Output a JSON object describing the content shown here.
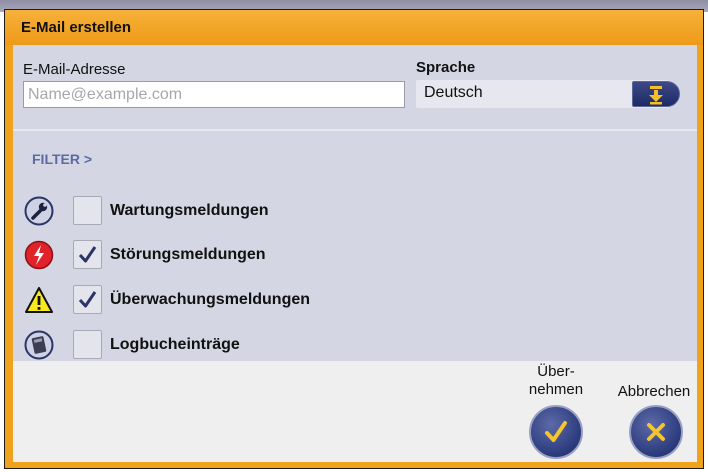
{
  "dialog": {
    "title": "E-Mail erstellen"
  },
  "email": {
    "label": "E-Mail-Adresse",
    "placeholder": "Name@example.com",
    "value": ""
  },
  "language": {
    "label": "Sprache",
    "selected": "Deutsch"
  },
  "filter": {
    "heading": "FILTER >",
    "items": [
      {
        "label": "Wartungsmeldungen",
        "checked": false,
        "icon": "wrench-icon"
      },
      {
        "label": "Störungsmeldungen",
        "checked": true,
        "icon": "fault-lightning-icon"
      },
      {
        "label": "Überwachungsmeldungen",
        "checked": true,
        "icon": "warning-triangle-icon"
      },
      {
        "label": "Logbucheinträge",
        "checked": false,
        "icon": "logbook-icon"
      }
    ]
  },
  "actions": {
    "accept_line1": "Über-",
    "accept_line2": "nehmen",
    "cancel": "Abbrechen"
  },
  "colors": {
    "accent": "#f0a21c",
    "button": "#2a3a7b",
    "check_icon": "#f5c431",
    "filter_text": "#5d6aa3"
  }
}
